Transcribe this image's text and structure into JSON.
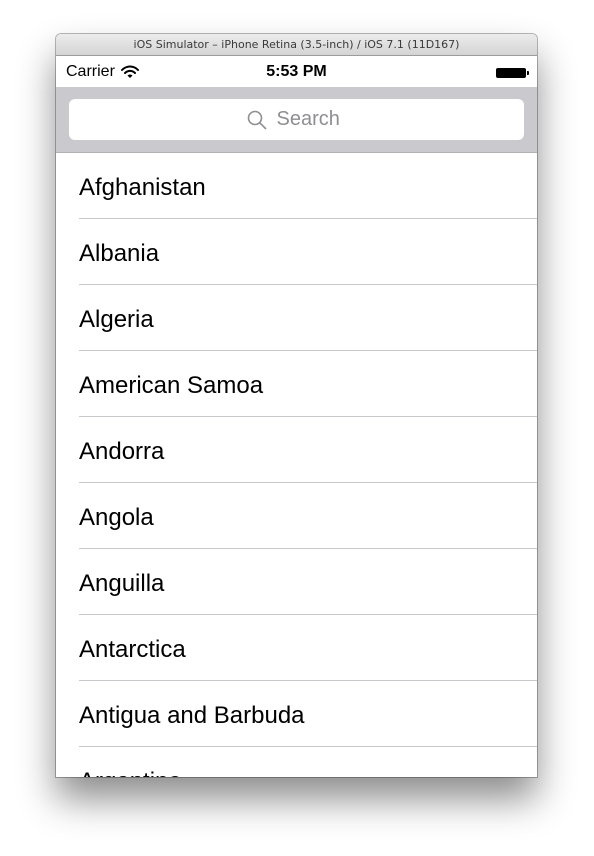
{
  "window": {
    "title": "iOS Simulator – iPhone Retina (3.5-inch) / iOS 7.1 (11D167)"
  },
  "status_bar": {
    "carrier": "Carrier",
    "time": "5:53 PM",
    "icons": [
      "wifi-icon",
      "battery-icon"
    ]
  },
  "search": {
    "placeholder": "Search",
    "value": ""
  },
  "countries": [
    "Afghanistan",
    "Albania",
    "Algeria",
    "American Samoa",
    "Andorra",
    "Angola",
    "Anguilla",
    "Antarctica",
    "Antigua and Barbuda",
    "Argentina"
  ],
  "colors": {
    "search_bar_bg": "#c9c9ce",
    "placeholder": "#8e8e93",
    "separator": "#c8c7cc"
  }
}
